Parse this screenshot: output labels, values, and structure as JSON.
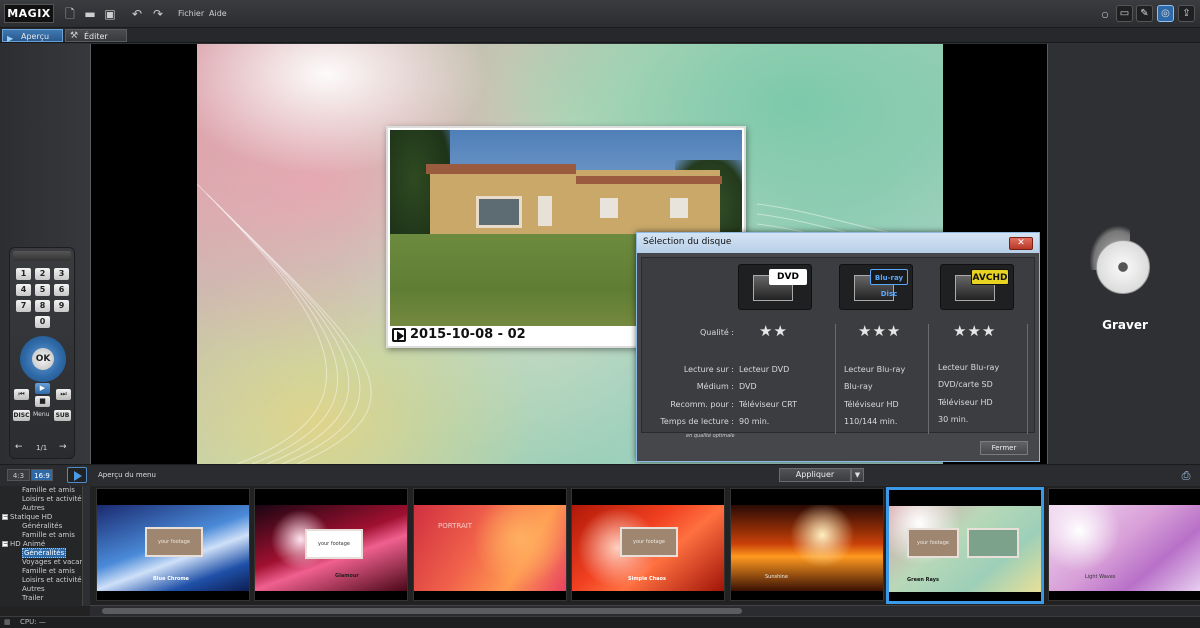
{
  "app": {
    "logo": "MAGIX",
    "menu": [
      "Fichier",
      "Aide"
    ]
  },
  "tabs": [
    {
      "label": "Aperçu",
      "active": true
    },
    {
      "label": "Éditer",
      "active": false
    }
  ],
  "remote": {
    "keys": [
      "1",
      "2",
      "3",
      "4",
      "5",
      "6",
      "7",
      "8",
      "9",
      "0"
    ],
    "ok": "OK",
    "disc": "DISC",
    "menu": "Menu",
    "sub": "SUB",
    "page": "1/1"
  },
  "preview": {
    "caption": "2015-10-08 - 02"
  },
  "dialog": {
    "title": "Sélection du disque",
    "close_glyph": "✕",
    "formats": [
      {
        "badge": "DVD",
        "stars": "★★",
        "lecture": "Lecteur DVD",
        "medium": "DVD",
        "recommande": "Téléviseur CRT",
        "temps": "90 min."
      },
      {
        "badge": "Blu-ray Disc",
        "stars": "★★★",
        "lecture": "Lecteur Blu-ray",
        "medium": "Blu-ray",
        "recommande": "Téléviseur HD",
        "temps": "110/144 min."
      },
      {
        "badge": "AVCHD",
        "stars": "★★★",
        "lecture": "Lecteur Blu-ray",
        "medium": "DVD/carte SD",
        "recommande": "Téléviseur HD",
        "temps": "30 min."
      }
    ],
    "labels": {
      "qualite": "Qualité :",
      "lecture": "Lecture sur :",
      "medium": "Médium :",
      "recommande": "Recomm. pour :",
      "temps": "Temps de lecture :",
      "note": "en qualité optimale"
    },
    "close_button": "Fermer"
  },
  "burn": {
    "label": "Graver"
  },
  "menubar": {
    "ratio_43": "4:3",
    "ratio_169": "16:9",
    "preview_label": "Aperçu du menu",
    "apply": "Appliquer",
    "apply_arrow": "▼"
  },
  "tree": [
    {
      "label": "Famille et amis",
      "indent": 2,
      "selected": false,
      "toggle": ""
    },
    {
      "label": "Loisirs et activités",
      "indent": 2,
      "selected": false,
      "toggle": ""
    },
    {
      "label": "Autres",
      "indent": 2,
      "selected": false,
      "toggle": ""
    },
    {
      "label": "Statique HD",
      "indent": 0,
      "selected": false,
      "toggle": "−"
    },
    {
      "label": "Généralités",
      "indent": 2,
      "selected": false,
      "toggle": ""
    },
    {
      "label": "Famille et amis",
      "indent": 2,
      "selected": false,
      "toggle": ""
    },
    {
      "label": "HD Animé",
      "indent": 0,
      "selected": false,
      "toggle": "−"
    },
    {
      "label": "Généralités",
      "indent": 2,
      "selected": true,
      "toggle": ""
    },
    {
      "label": "Voyages et vacan",
      "indent": 2,
      "selected": false,
      "toggle": ""
    },
    {
      "label": "Famille et amis",
      "indent": 2,
      "selected": false,
      "toggle": ""
    },
    {
      "label": "Loisirs et activités",
      "indent": 2,
      "selected": false,
      "toggle": ""
    },
    {
      "label": "Autres",
      "indent": 2,
      "selected": false,
      "toggle": ""
    },
    {
      "label": "Trailer",
      "indent": 2,
      "selected": false,
      "toggle": ""
    }
  ],
  "templates": [
    {
      "name": "Blue Chrome",
      "card": "your footage"
    },
    {
      "name": "Glamour",
      "card": "your footage"
    },
    {
      "name": "PORTRAIT",
      "card": ""
    },
    {
      "name": "Simple Chaos",
      "card": "your footage"
    },
    {
      "name": "Sunshine",
      "card": ""
    },
    {
      "name": "Green Rays",
      "card": "your footage"
    },
    {
      "name": "Light Waves",
      "card": ""
    }
  ],
  "status": {
    "cpu": "CPU: —"
  }
}
